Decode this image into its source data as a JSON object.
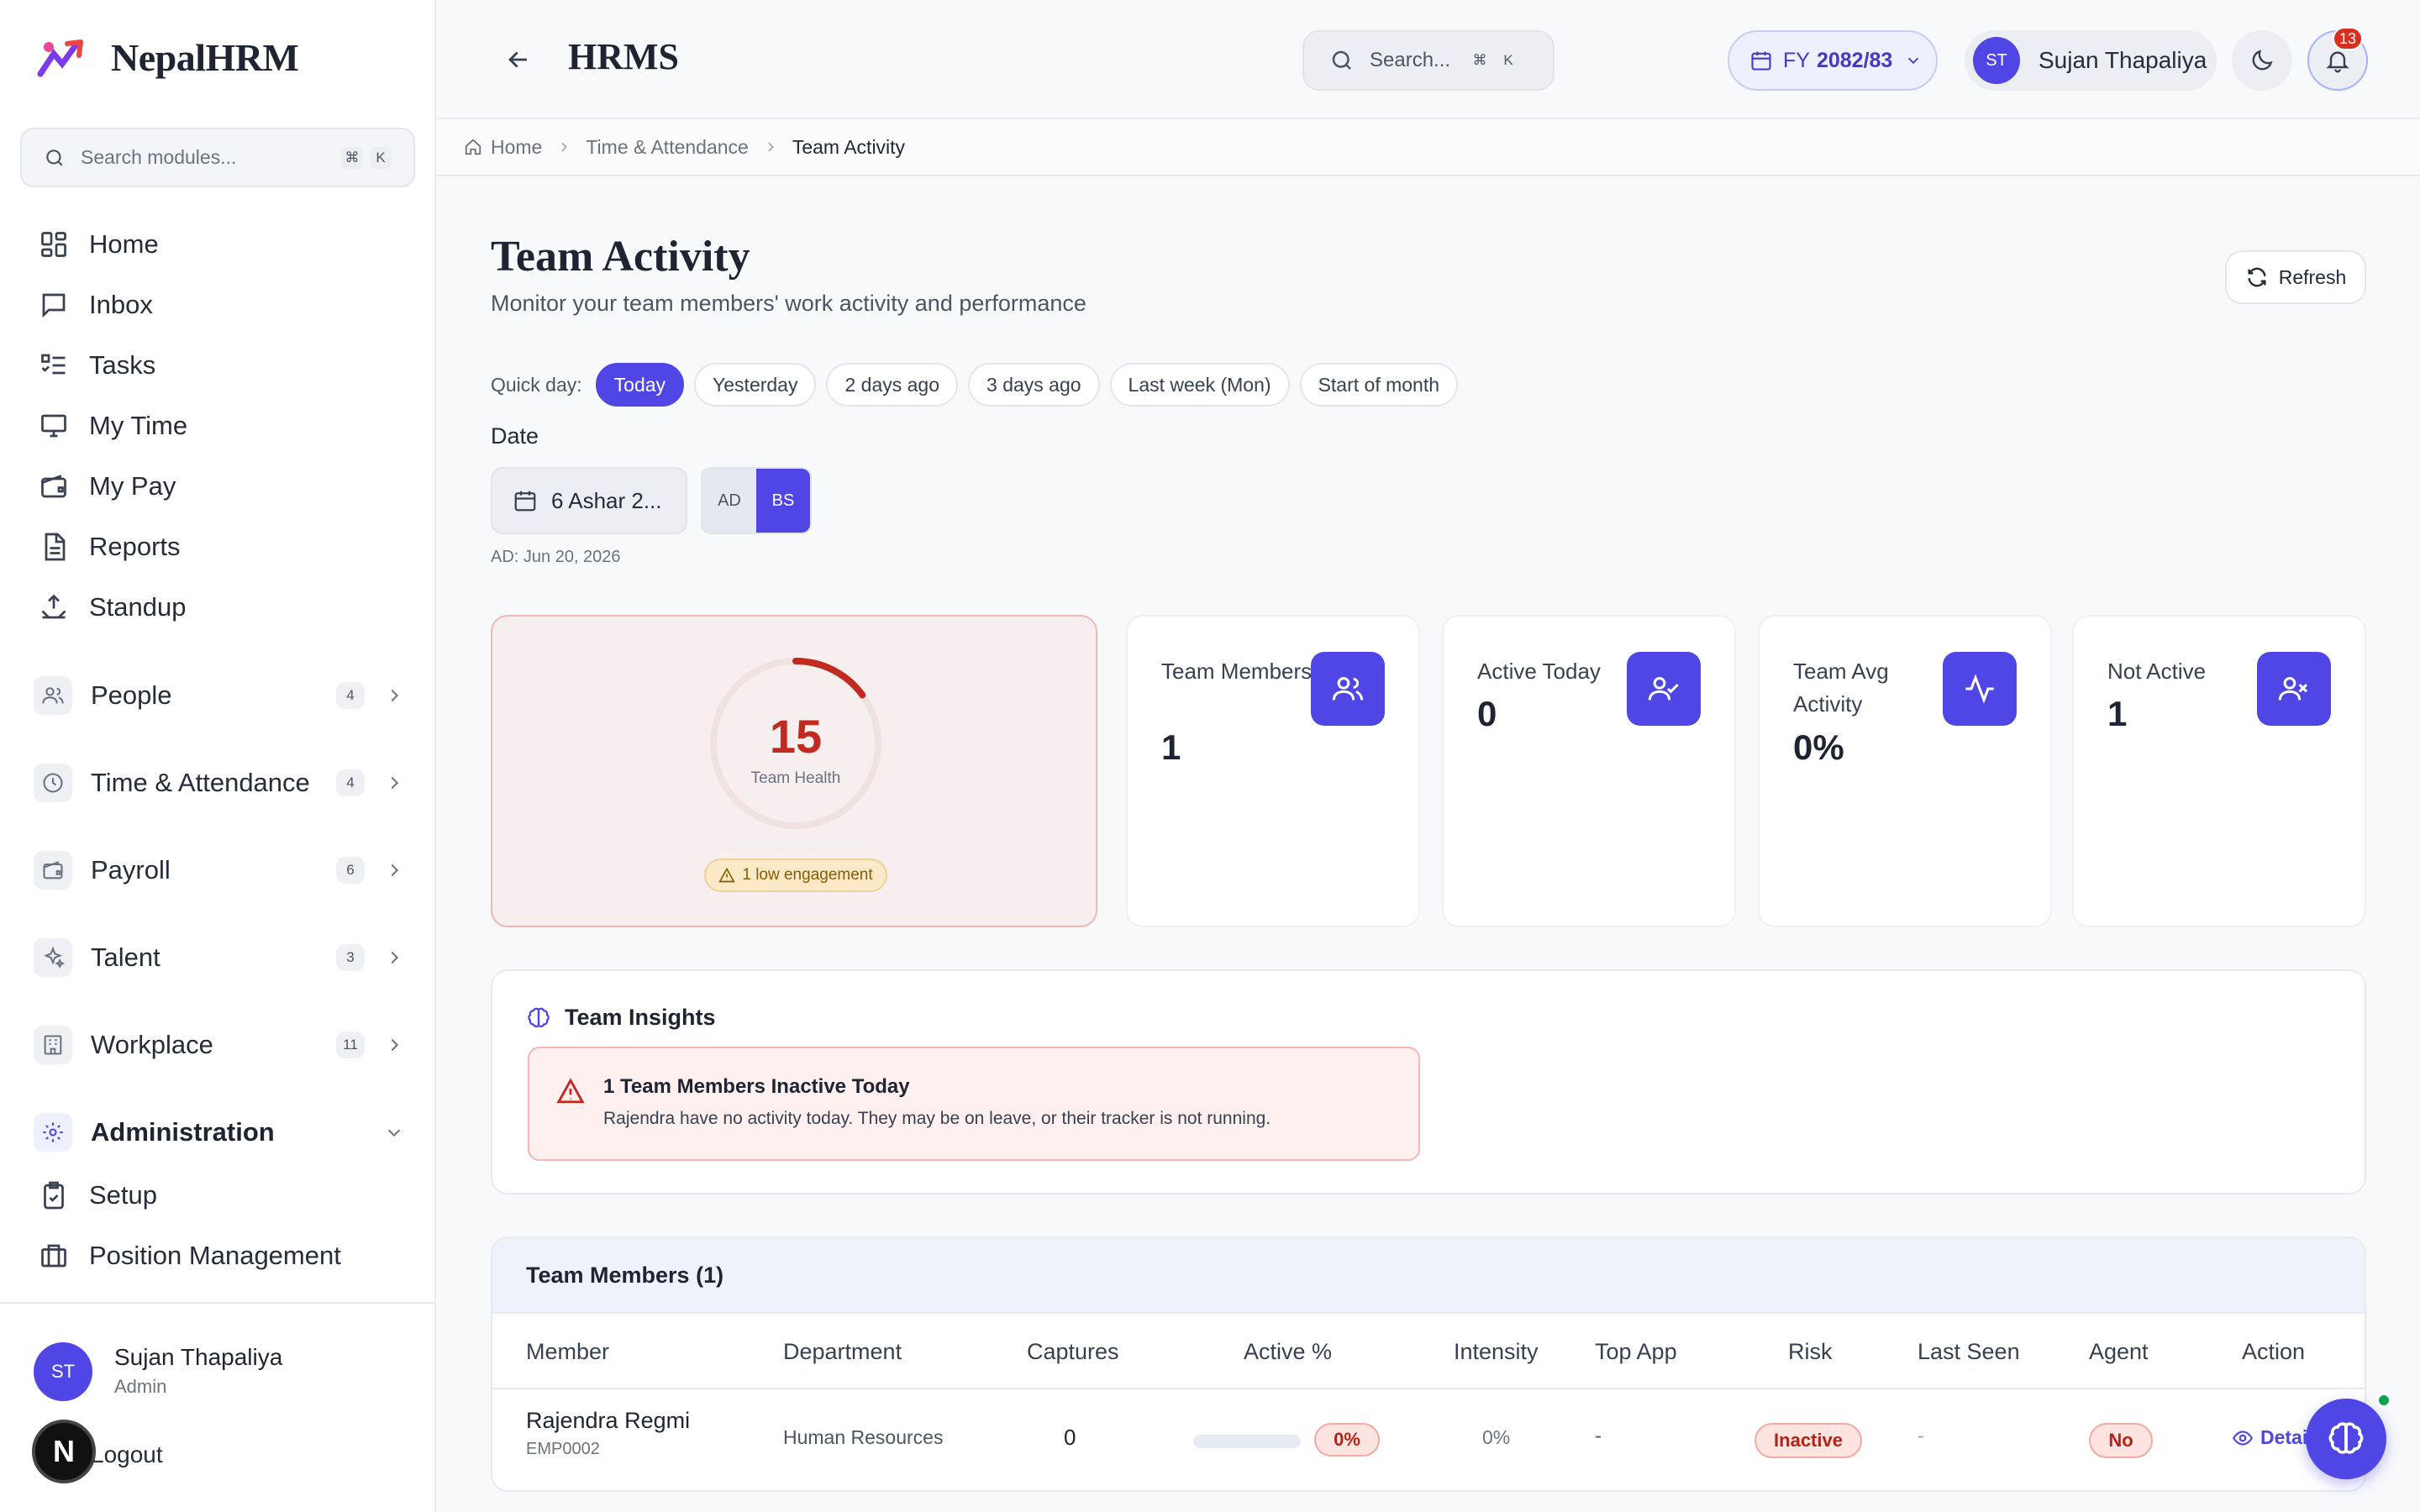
{
  "brand": {
    "name": "NepalHRM"
  },
  "sidebar": {
    "search_placeholder": "Search modules...",
    "kbd1": "⌘",
    "kbd2": "K",
    "items": [
      {
        "label": "Home"
      },
      {
        "label": "Inbox"
      },
      {
        "label": "Tasks"
      },
      {
        "label": "My Time"
      },
      {
        "label": "My Pay"
      },
      {
        "label": "Reports"
      },
      {
        "label": "Standup"
      }
    ],
    "groups": [
      {
        "label": "People",
        "count": "4"
      },
      {
        "label": "Time & Attendance",
        "count": "4"
      },
      {
        "label": "Payroll",
        "count": "6"
      },
      {
        "label": "Talent",
        "count": "3"
      },
      {
        "label": "Workplace",
        "count": "11"
      }
    ],
    "admin": {
      "label": "Administration",
      "items": [
        {
          "label": "Setup"
        },
        {
          "label": "Position Management"
        }
      ]
    },
    "user": {
      "initials": "ST",
      "name": "Sujan Thapaliya",
      "role": "Admin",
      "logout": "Logout"
    }
  },
  "header": {
    "title": "HRMS",
    "search_placeholder": "Search...",
    "kbd1": "⌘",
    "kbd2": "K",
    "fy_prefix": "FY",
    "fy_value": "2082/83",
    "user_initials": "ST",
    "user_name": "Sujan Thapaliya",
    "notifications": "13"
  },
  "breadcrumb": [
    "Home",
    "Time & Attendance",
    "Team Activity"
  ],
  "page": {
    "title": "Team Activity",
    "subtitle": "Monitor your team members' work activity and performance",
    "refresh": "Refresh",
    "quick_label": "Quick day:",
    "quick_days": [
      "Today",
      "Yesterday",
      "2 days ago",
      "3 days ago",
      "Last week (Mon)",
      "Start of month"
    ],
    "date_label": "Date",
    "date_value": "6 Ashar 2...",
    "calendar_ad": "AD",
    "calendar_bs": "BS",
    "ad_note": "AD: Jun 20, 2026"
  },
  "health": {
    "score": "15",
    "score_fraction": 0.15,
    "label": "Team Health",
    "badge": "1 low engagement"
  },
  "stats": [
    {
      "label": "Team Members",
      "value": "1",
      "icon": "users-icon"
    },
    {
      "label": "Active Today",
      "value": "0",
      "icon": "user-check-icon"
    },
    {
      "label": "Team Avg Activity",
      "value": "0%",
      "icon": "activity-icon"
    },
    {
      "label": "Not Active",
      "value": "1",
      "icon": "user-x-icon"
    }
  ],
  "insights": {
    "title": "Team Insights",
    "alert_title": "1 Team Members Inactive Today",
    "alert_desc": "Rajendra have no activity today. They may be on leave, or their tracker is not running."
  },
  "members": {
    "title": "Team Members (1)",
    "columns": [
      "Member",
      "Department",
      "Captures",
      "Active %",
      "Intensity",
      "Top App",
      "Risk",
      "Last Seen",
      "Agent",
      "Action"
    ],
    "rows": [
      {
        "name": "Rajendra Regmi",
        "id": "EMP0002",
        "department": "Human Resources",
        "captures": "0",
        "active_pct": "0%",
        "intensity": "0%",
        "top_app": "-",
        "risk": "Inactive",
        "last_seen": "-",
        "agent": "No",
        "action": "Detail"
      }
    ]
  },
  "colors": {
    "accent": "#4f46e5",
    "danger": "#c2291f",
    "warning_bg": "#fbe9c7"
  }
}
